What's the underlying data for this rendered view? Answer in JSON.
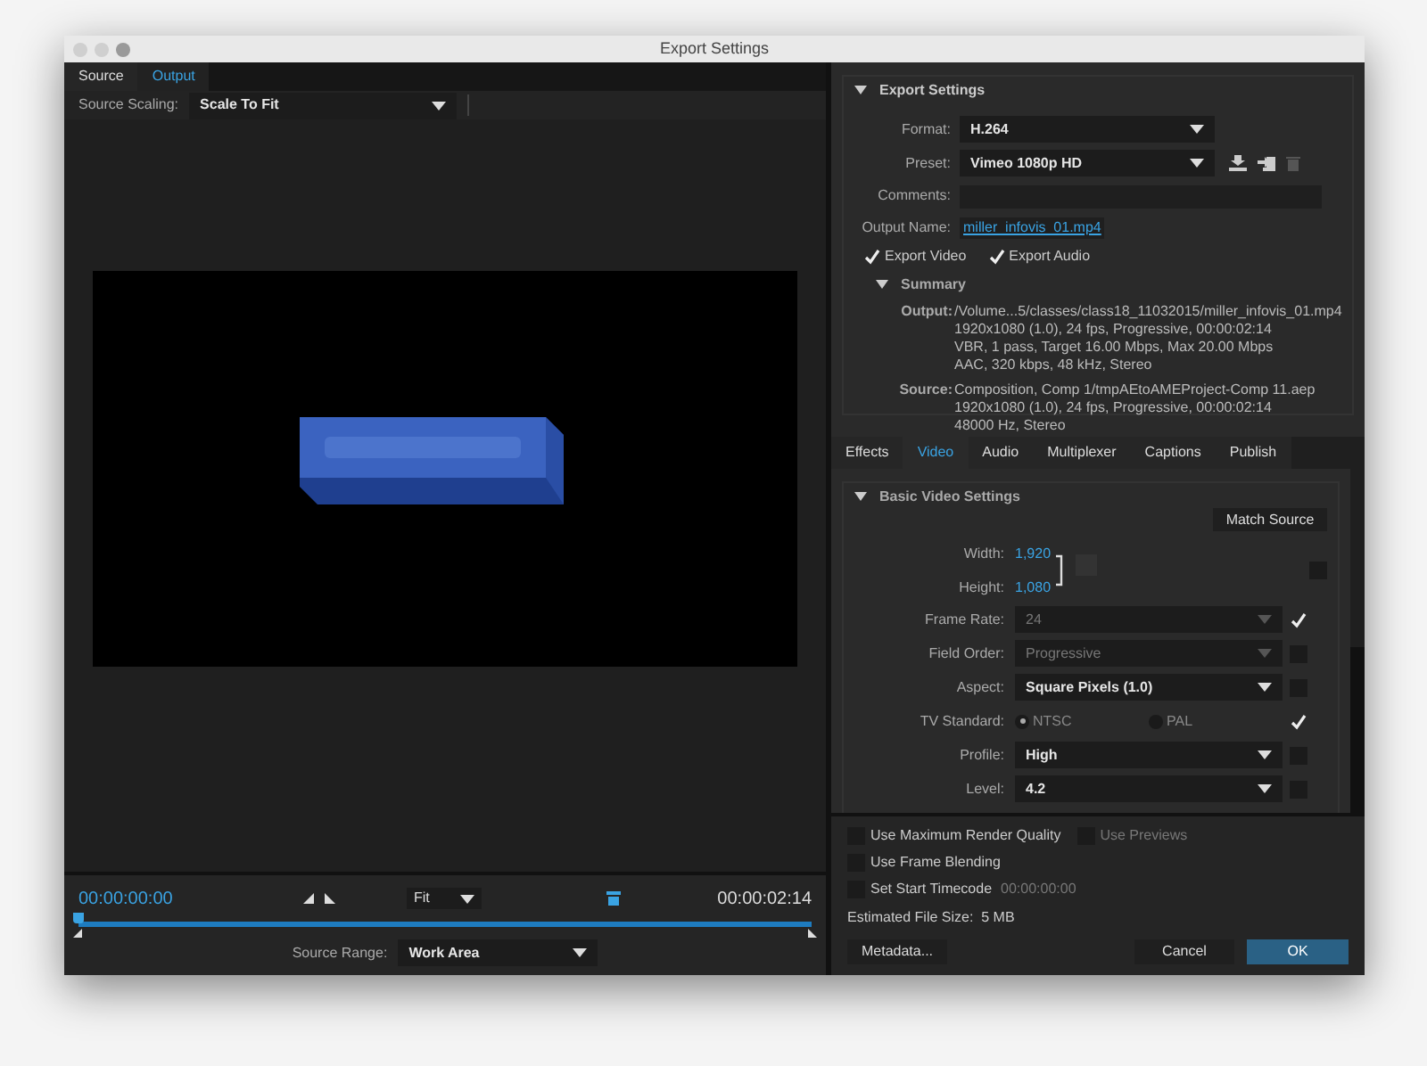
{
  "window": {
    "title": "Export Settings"
  },
  "source_tabs": [
    {
      "label": "Source",
      "selected": false
    },
    {
      "label": "Output",
      "selected": true
    }
  ],
  "source_scaling": {
    "label": "Source Scaling:",
    "value": "Scale To Fit"
  },
  "timeline": {
    "current_time": "00:00:00:00",
    "zoom": "Fit",
    "end_time": "00:00:02:14",
    "range_label": "Source Range:",
    "range_value": "Work Area"
  },
  "export_settings": {
    "title": "Export Settings",
    "expanded": true,
    "format": {
      "label": "Format:",
      "value": "H.264"
    },
    "preset": {
      "label": "Preset:",
      "value": "Vimeo 1080p HD"
    },
    "comments": {
      "label": "Comments:"
    },
    "output_name": {
      "label": "Output Name:",
      "value": "miller_infovis_01.mp4"
    },
    "exports": [
      {
        "label": "Export Video",
        "checked": true
      },
      {
        "label": "Export Audio",
        "checked": true
      }
    ],
    "summary": {
      "title": "Summary",
      "expanded": true,
      "entries": [
        {
          "label": "Output:",
          "lines": [
            "/Volume...5/classes/class18_11032015/miller_infovis_01.mp4",
            "1920x1080 (1.0), 24 fps, Progressive, 00:00:02:14",
            "VBR, 1 pass, Target 16.00 Mbps, Max 20.00 Mbps",
            "AAC, 320 kbps, 48 kHz, Stereo"
          ]
        },
        {
          "label": "Source:",
          "lines": [
            "Composition, Comp 1/tmpAEtoAMEProject-Comp 11.aep",
            "1920x1080 (1.0), 24 fps, Progressive, 00:00:02:14",
            "48000 Hz, Stereo"
          ]
        }
      ]
    }
  },
  "settings_tabs": [
    {
      "label": "Effects",
      "selected": false
    },
    {
      "label": "Video",
      "selected": true
    },
    {
      "label": "Audio",
      "selected": false
    },
    {
      "label": "Multiplexer",
      "selected": false
    },
    {
      "label": "Captions",
      "selected": false
    },
    {
      "label": "Publish",
      "selected": false
    }
  ],
  "basic_video": {
    "title": "Basic Video Settings",
    "expanded": true,
    "match_source": "Match Source",
    "width": {
      "label": "Width:",
      "value": "1,920"
    },
    "height": {
      "label": "Height:",
      "value": "1,080"
    },
    "size_checked": false,
    "rows": [
      {
        "kind": "dropdown",
        "label": "Frame Rate:",
        "value": "24",
        "disabled": true,
        "checked": true
      },
      {
        "kind": "dropdown",
        "label": "Field Order:",
        "value": "Progressive",
        "disabled": true,
        "checked": false
      },
      {
        "kind": "dropdown",
        "label": "Aspect:",
        "value": "Square Pixels (1.0)",
        "disabled": false,
        "checked": false
      },
      {
        "kind": "radio",
        "label": "TV Standard:",
        "options": [
          {
            "label": "NTSC",
            "selected": true
          },
          {
            "label": "PAL",
            "selected": false
          }
        ],
        "checked": true
      },
      {
        "kind": "dropdown",
        "label": "Profile:",
        "value": "High",
        "disabled": false,
        "checked": false
      },
      {
        "kind": "dropdown",
        "label": "Level:",
        "value": "4.2",
        "disabled": false,
        "checked": false
      }
    ]
  },
  "options": [
    {
      "label": "Use Maximum Render Quality",
      "checked": false,
      "disabled": false,
      "extra": {
        "label": "Use Previews",
        "checked": false,
        "disabled": true
      }
    },
    {
      "label": "Use Frame Blending",
      "checked": false,
      "disabled": false
    },
    {
      "label": "Set Start Timecode",
      "checked": false,
      "disabled": false,
      "value": "00:00:00:00"
    }
  ],
  "estimated_size": "Estimated File Size:  5 MB",
  "buttons": {
    "metadata": "Metadata...",
    "cancel": "Cancel",
    "ok": "OK"
  }
}
